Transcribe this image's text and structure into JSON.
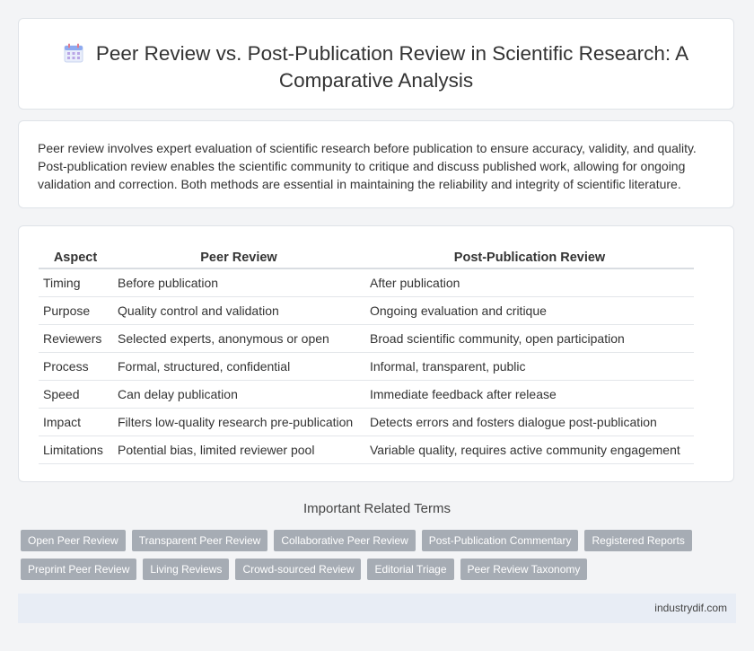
{
  "header": {
    "title": "Peer Review vs. Post-Publication Review in Scientific Research: A Comparative Analysis",
    "icon": "calendar-icon"
  },
  "intro": "Peer review involves expert evaluation of scientific research before publication to ensure accuracy, validity, and quality. Post-publication review enables the scientific community to critique and discuss published work, allowing for ongoing validation and correction. Both methods are essential in maintaining the reliability and integrity of scientific literature.",
  "table": {
    "headers": [
      "Aspect",
      "Peer Review",
      "Post-Publication Review"
    ],
    "rows": [
      [
        "Timing",
        "Before publication",
        "After publication"
      ],
      [
        "Purpose",
        "Quality control and validation",
        "Ongoing evaluation and critique"
      ],
      [
        "Reviewers",
        "Selected experts, anonymous or open",
        "Broad scientific community, open participation"
      ],
      [
        "Process",
        "Formal, structured, confidential",
        "Informal, transparent, public"
      ],
      [
        "Speed",
        "Can delay publication",
        "Immediate feedback after release"
      ],
      [
        "Impact",
        "Filters low-quality research pre-publication",
        "Detects errors and fosters dialogue post-publication"
      ],
      [
        "Limitations",
        "Potential bias, limited reviewer pool",
        "Variable quality, requires active community engagement"
      ]
    ]
  },
  "related": {
    "title": "Important Related Terms",
    "rows": [
      [
        "Open Peer Review",
        "Transparent Peer Review",
        "Collaborative Peer Review",
        "Post-Publication Commentary",
        "Registered Reports"
      ],
      [
        "Preprint Peer Review",
        "Living Reviews",
        "Crowd-sourced Review",
        "Editorial Triage",
        "Peer Review Taxonomy"
      ]
    ]
  },
  "footer": {
    "site": "industrydif.com"
  },
  "colors": {
    "tag_bg": "#a6acb4",
    "footer_bg": "#e8edf5",
    "page_bg": "#f3f4f6",
    "icon_accent": "#5b8def"
  }
}
